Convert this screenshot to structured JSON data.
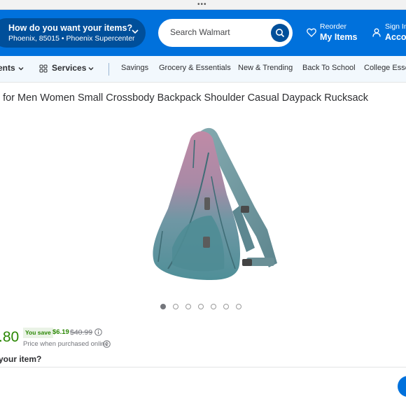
{
  "browser": {
    "dots": "•••"
  },
  "header": {
    "location_title": "How do you want your items?",
    "location_sub": "Phoenix, 85015 • Phoenix Supercenter",
    "search_placeholder": "Search Walmart",
    "reorder_line1": "Reorder",
    "reorder_line2": "My Items",
    "signin_line1": "Sign In",
    "signin_line2": "Account",
    "brand_color": "#0071dc"
  },
  "nav": {
    "departments": "ents",
    "services": "Services",
    "links": [
      "Savings",
      "Grocery & Essentials",
      "New & Trending",
      "Back To School",
      "College Essen"
    ]
  },
  "product": {
    "title": "g for Men Women Small Crossbody Backpack Shoulder Casual Daypack Rucksack",
    "image_icon": "sling-bag-image",
    "carousel_count": 7,
    "carousel_active": 0,
    "price": ".80",
    "you_save_label": "You save",
    "save_amount": "$6.19",
    "was_price": "$40.99",
    "price_note": "Price when purchased online",
    "question": "your item?"
  }
}
